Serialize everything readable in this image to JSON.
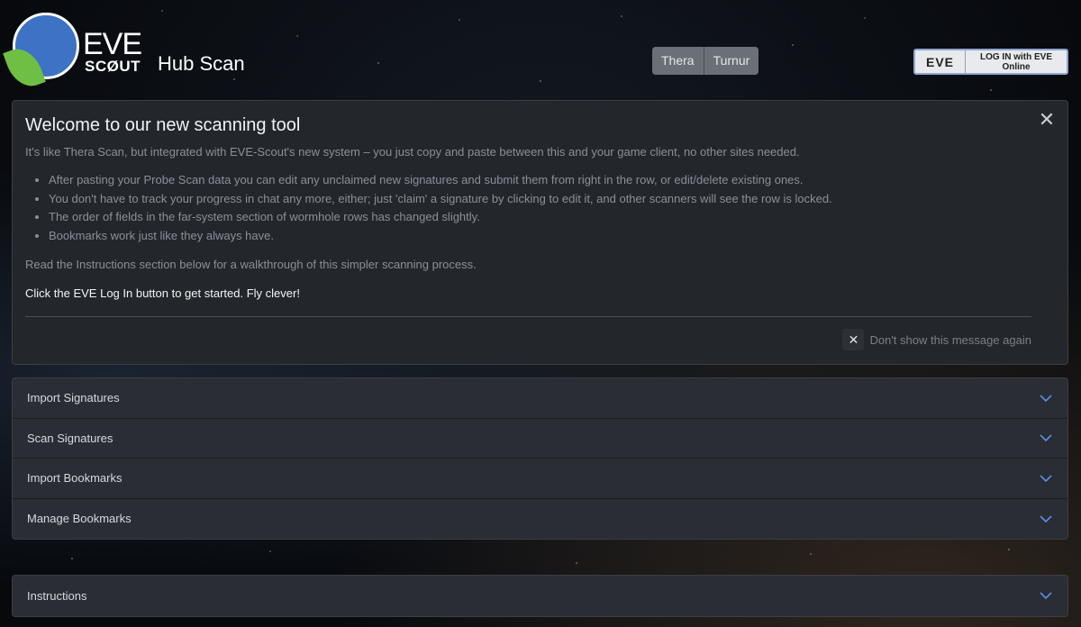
{
  "header": {
    "logo": {
      "eve": "EVE",
      "scout": "SCØUT"
    },
    "title": "Hub Scan",
    "hubs": [
      "Thera",
      "Turnur"
    ],
    "login": {
      "eve": "EVE",
      "label": "LOG IN with EVE Online"
    }
  },
  "welcome": {
    "title": "Welcome to our new scanning tool",
    "intro": "It's like Thera Scan, but integrated with EVE-Scout's new system – you just copy and paste between this and your game client, no other sites needed.",
    "bullets": [
      "After pasting your Probe Scan data you can edit any unclaimed new signatures and submit them from right in the row, or edit/delete existing ones.",
      "You don't have to track your progress in chat any more, either; just 'claim' a signature by clicking to edit it, and other scanners will see the row is locked.",
      "The order of fields in the far-system section of wormhole rows has changed slightly.",
      "Bookmarks work just like they always have."
    ],
    "read": "Read the Instructions section below for a walkthrough of this simpler scanning process.",
    "cta": "Click the EVE Log In button to get started. Fly clever!",
    "close_glyph": "✕",
    "dismiss_glyph": "✕",
    "dismiss_label": "Don't show this message again"
  },
  "sections": [
    {
      "label": "Import Signatures",
      "icon": "chevron-down-icon"
    },
    {
      "label": "Scan Signatures",
      "icon": "chevron-down-icon"
    },
    {
      "label": "Import Bookmarks",
      "icon": "chevron-down-icon"
    },
    {
      "label": "Manage Bookmarks",
      "icon": "chevron-down-icon"
    }
  ],
  "instructions": {
    "label": "Instructions",
    "icon": "chevron-down-icon"
  },
  "colors": {
    "background": "#0b0e13",
    "panel": "#23262b",
    "accordion": "#2a2d33",
    "chevron": "#5b8ee6",
    "logo_blue": "#3d72c4",
    "logo_green": "#6fbf44"
  }
}
